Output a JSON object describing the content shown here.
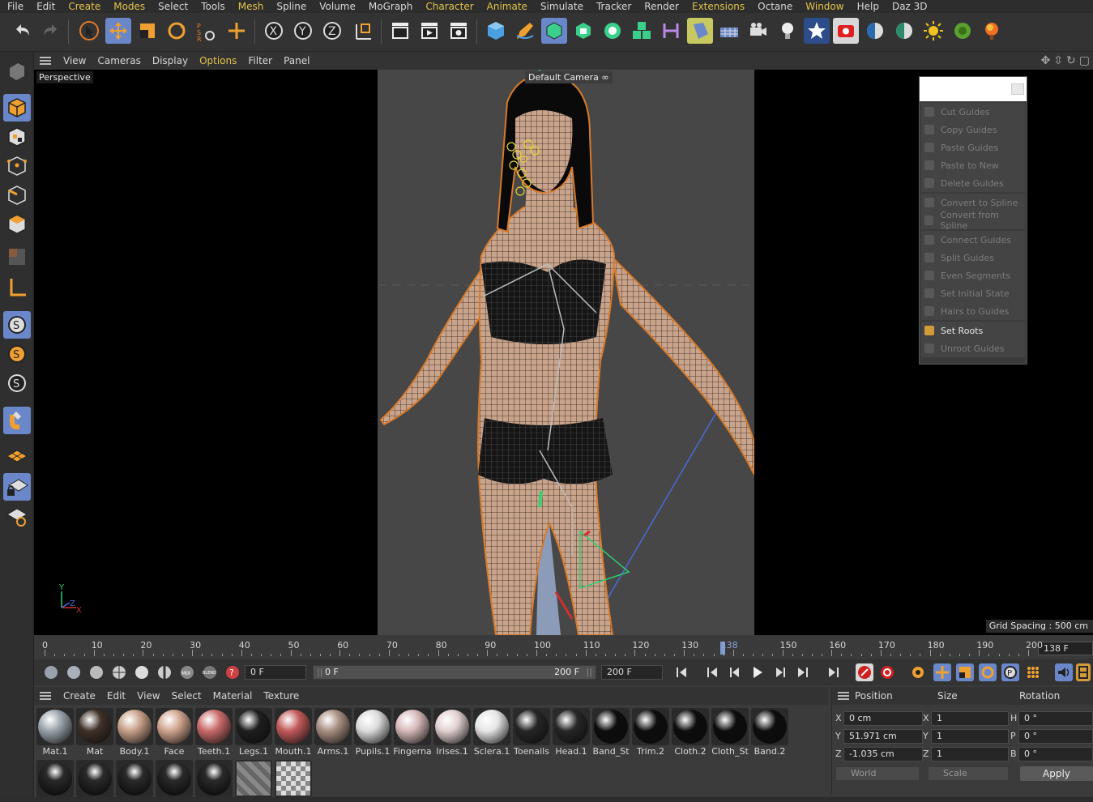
{
  "menu": [
    "File",
    "Edit",
    "Create",
    "Modes",
    "Select",
    "Tools",
    "Mesh",
    "Spline",
    "Volume",
    "MoGraph",
    "Character",
    "Animate",
    "Simulate",
    "Tracker",
    "Render",
    "Extensions",
    "Octane",
    "Window",
    "Help",
    "Daz 3D"
  ],
  "menu_highlight": [
    "Create",
    "Modes",
    "Mesh",
    "Character",
    "Animate",
    "Extensions",
    "Window"
  ],
  "viewport": {
    "menu": [
      "View",
      "Cameras",
      "Display",
      "Options",
      "Filter",
      "Panel"
    ],
    "menu_highlight": "Options",
    "projection_label": "Perspective",
    "camera_label": "Default Camera",
    "grid_spacing": "Grid Spacing : 500 cm",
    "axis_y": "Y",
    "axis_z": "Z",
    "axis_x": "X"
  },
  "guides_menu": {
    "groups": [
      [
        "Cut Guides",
        "Copy Guides",
        "Paste Guides",
        "Paste to New",
        "Delete Guides"
      ],
      [
        "Convert to Spline",
        "Convert from Spline"
      ],
      [
        "Connect Guides",
        "Split Guides",
        "Even Segments",
        "Set Initial State",
        "Hairs to Guides"
      ],
      [
        "Set Roots",
        "Unroot Guides"
      ]
    ],
    "enabled": [
      "Set Roots"
    ]
  },
  "timeline": {
    "ticks": [
      "0",
      "10",
      "20",
      "30",
      "40",
      "50",
      "60",
      "70",
      "80",
      "90",
      "100",
      "110",
      "120",
      "130",
      "138",
      "150",
      "160",
      "170",
      "180",
      "190",
      "200"
    ],
    "current_frame": "138 F",
    "start_field": "0 F",
    "range_start": "0 F",
    "range_end": "200 F",
    "end_field": "200 F"
  },
  "materials": {
    "menu": [
      "Create",
      "Edit",
      "View",
      "Select",
      "Material",
      "Texture"
    ],
    "row1": [
      {
        "name": "Mat.1",
        "color": "#9aa3ab"
      },
      {
        "name": "Mat",
        "color": "#3e3128"
      },
      {
        "name": "Body.1",
        "color": "#c7a089"
      },
      {
        "name": "Face",
        "color": "#d0a48e"
      },
      {
        "name": "Teeth.1",
        "color": "#c96a6a"
      },
      {
        "name": "Legs.1",
        "color": "#1e1e1e"
      },
      {
        "name": "Mouth.1",
        "color": "#c25a5a"
      },
      {
        "name": "Arms.1",
        "color": "#a98f82"
      },
      {
        "name": "Pupils.1",
        "color": "#dcdcdc"
      },
      {
        "name": "Fingerna",
        "color": "#d7b9b9"
      },
      {
        "name": "Irises.1",
        "color": "#e2d1d1"
      },
      {
        "name": "Sclera.1",
        "color": "#e6e6e6"
      },
      {
        "name": "Toenails",
        "color": "#262626"
      },
      {
        "name": "Head.1",
        "color": "#262626"
      },
      {
        "name": "Band_St",
        "color": "#0d0d0d"
      },
      {
        "name": "Trim.2",
        "color": "#0d0d0d"
      },
      {
        "name": "Cloth.2",
        "color": "#0d0d0d"
      },
      {
        "name": "Cloth_St",
        "color": "#0d0d0d"
      },
      {
        "name": "Band.2",
        "color": "#0d0d0d"
      }
    ],
    "row2_count_note": "7"
  },
  "coordinates": {
    "headers": [
      "Position",
      "Size",
      "Rotation"
    ],
    "position": {
      "X": "0 cm",
      "Y": "51.971 cm",
      "Z": "-1.035 cm"
    },
    "size": {
      "X": "1",
      "Y": "1",
      "Z": "1"
    },
    "rotation": {
      "H": "0 °",
      "P": "0 °",
      "B": "0 °"
    },
    "coord_mode": "World",
    "size_mode": "Scale",
    "apply_label": "Apply"
  },
  "colors": {
    "accent": "#6a87c9",
    "highlight_text": "#e2c24a",
    "outline_orange": "#d77a2a"
  }
}
